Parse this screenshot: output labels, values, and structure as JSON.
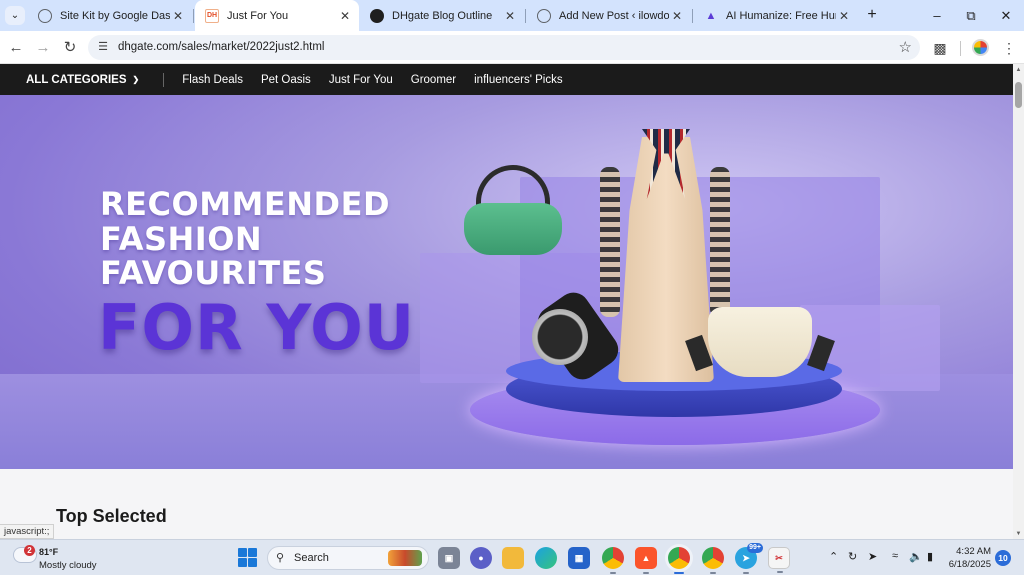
{
  "browser": {
    "tabs": [
      {
        "title": "Site Kit by Google Dashboard",
        "favicon": "globe-icon",
        "active": false
      },
      {
        "title": "Just For You",
        "favicon": "dhgate-icon",
        "favicon_text": "DH",
        "active": true
      },
      {
        "title": "DHgate Blog Outline",
        "favicon": "chatgpt-icon",
        "active": false
      },
      {
        "title": "Add New Post ‹ ilowdo — WordPress",
        "favicon": "globe-icon",
        "active": false
      },
      {
        "title": "AI Humanize: Free Humanizer",
        "favicon": "ai-humanize-icon",
        "active": false
      }
    ],
    "url": "dhgate.com/sales/market/2022just2.html",
    "status_text": "javascript:;"
  },
  "site": {
    "nav": {
      "all_categories": "ALL CATEGORIES",
      "items": [
        "Flash Deals",
        "Pet Oasis",
        "Just For You",
        "Groomer",
        "influencers' Picks"
      ]
    },
    "hero": {
      "line1": "RECOMMENDED",
      "line2": "FASHION",
      "line3": "FAVOURITES",
      "highlight": "FOR YOU"
    },
    "section_title": "Top Selected"
  },
  "taskbar": {
    "weather": {
      "temp": "81°F",
      "condition": "Mostly cloudy",
      "alert_count": "2"
    },
    "search_label": "Search",
    "telegram_count": "99+",
    "time": "4:32 AM",
    "date": "6/18/2025",
    "notifications": "10"
  },
  "colors": {
    "tabstrip": "#d3e3fd",
    "nav_bar": "#1b1b1b",
    "hero_accent": "#5b34d6",
    "windows_accent": "#1a78d8"
  }
}
